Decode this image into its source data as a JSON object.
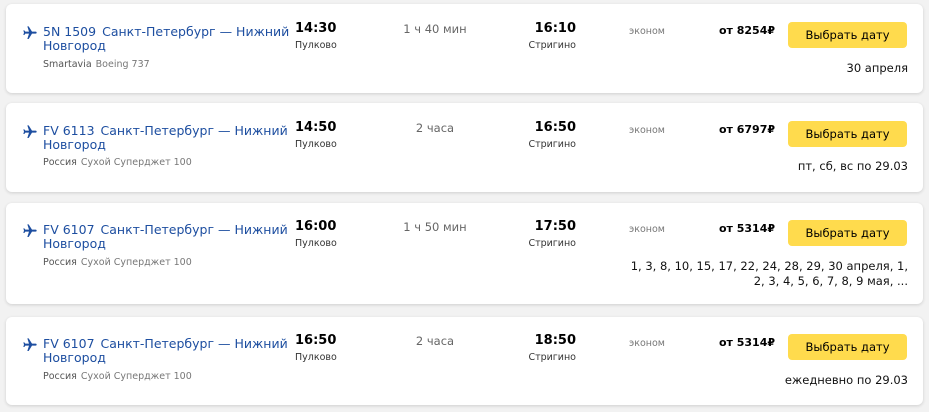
{
  "colors": {
    "accent_button": "#ffdb4d",
    "link": "#1d4ea0",
    "background": "#f2f2f2"
  },
  "flights": [
    {
      "flight_number": "5N 1509",
      "route": "Санкт-Петербург — Нижний Новгород",
      "carrier": "Smartavia",
      "aircraft": "Boeing 737",
      "departure_time": "14:30",
      "departure_airport": "Пулково",
      "duration": "1 ч 40 мин",
      "arrival_time": "16:10",
      "arrival_airport": "Стригино",
      "fare_class": "эконом",
      "price": "от 8254₽",
      "button_label": "Выбрать дату",
      "schedule": "30 апреля"
    },
    {
      "flight_number": "FV 6113",
      "route": "Санкт-Петербург — Нижний Новгород",
      "carrier": "Россия",
      "aircraft": "Сухой Суперджет 100",
      "departure_time": "14:50",
      "departure_airport": "Пулково",
      "duration": "2 часа",
      "arrival_time": "16:50",
      "arrival_airport": "Стригино",
      "fare_class": "эконом",
      "price": "от 6797₽",
      "button_label": "Выбрать дату",
      "schedule": "пт, сб, вс по 29.03"
    },
    {
      "flight_number": "FV 6107",
      "route": "Санкт-Петербург — Нижний Новгород",
      "carrier": "Россия",
      "aircraft": "Сухой Суперджет 100",
      "departure_time": "16:00",
      "departure_airport": "Пулково",
      "duration": "1 ч 50 мин",
      "arrival_time": "17:50",
      "arrival_airport": "Стригино",
      "fare_class": "эконом",
      "price": "от 5314₽",
      "button_label": "Выбрать дату",
      "schedule": "1, 3, 8, 10, 15, 17, 22, 24, 28, 29, 30 апреля, 1, 2, 3, 4, 5, 6, 7, 8, 9 мая, ..."
    },
    {
      "flight_number": "FV 6107",
      "route": "Санкт-Петербург — Нижний Новгород",
      "carrier": "Россия",
      "aircraft": "Сухой Суперджет 100",
      "departure_time": "16:50",
      "departure_airport": "Пулково",
      "duration": "2 часа",
      "arrival_time": "18:50",
      "arrival_airport": "Стригино",
      "fare_class": "эконом",
      "price": "от 5314₽",
      "button_label": "Выбрать дату",
      "schedule": "ежедневно по 29.03"
    }
  ]
}
